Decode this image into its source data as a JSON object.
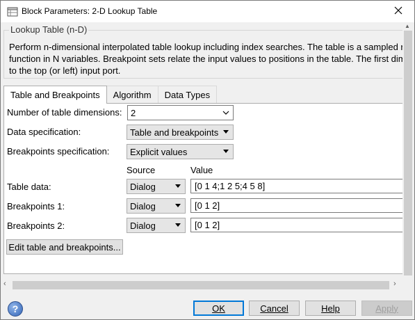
{
  "window": {
    "title": "Block Parameters: 2-D Lookup Table"
  },
  "group": {
    "title": "Lookup Table (n-D)",
    "description_lines": [
      "Perform n-dimensional interpolated table lookup including index searches. The table is a sampled re",
      "function in N variables. Breakpoint sets relate the input values to positions in the table. The first dim",
      "to the top (or left) input port."
    ]
  },
  "tabs": [
    {
      "label": "Table and Breakpoints",
      "active": true
    },
    {
      "label": "Algorithm",
      "active": false
    },
    {
      "label": "Data Types",
      "active": false
    }
  ],
  "params": {
    "num_dims": {
      "label": "Number of table dimensions:",
      "value": "2"
    },
    "data_spec": {
      "label": "Data specification:",
      "value": "Table and breakpoints"
    },
    "bp_spec": {
      "label": "Breakpoints specification:",
      "value": "Explicit values"
    },
    "columns": {
      "source": "Source",
      "value": "Value"
    },
    "table_data": {
      "label": "Table data:",
      "source": "Dialog",
      "value": "[0 1 4;1 2 5;4 5 8]"
    },
    "bp1": {
      "label": "Breakpoints 1:",
      "source": "Dialog",
      "value": "[0 1 2]"
    },
    "bp2": {
      "label": "Breakpoints 2:",
      "source": "Dialog",
      "value": "[0 1 2]"
    },
    "edit_button": "Edit table and breakpoints..."
  },
  "footer": {
    "help_icon": "?",
    "ok": "OK",
    "cancel": "Cancel",
    "help": "Help",
    "apply": "Apply"
  },
  "icons": {
    "title_icon": "simulink-block-icon",
    "close": "close-icon",
    "dropdown": "chevron-down-icon"
  }
}
